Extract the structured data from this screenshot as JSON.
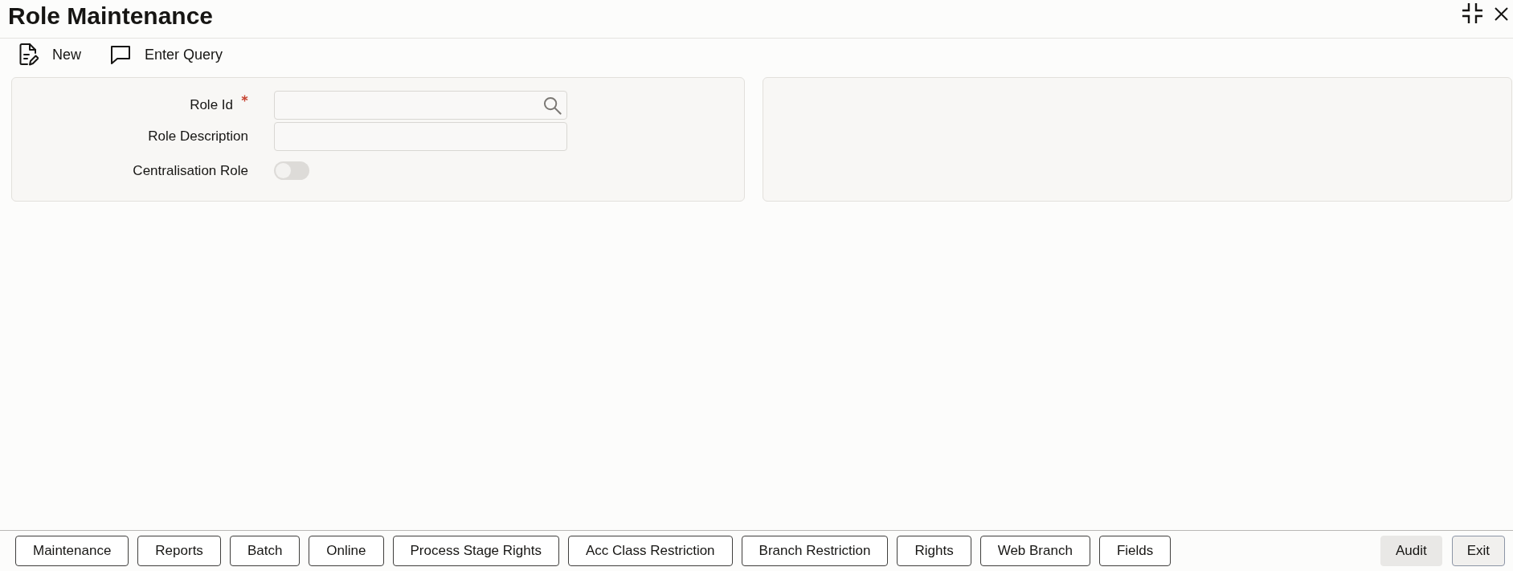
{
  "window": {
    "title": "Role Maintenance"
  },
  "toolbar": [
    {
      "label": "New",
      "kind": "new"
    },
    {
      "label": "Enter Query",
      "kind": "query"
    }
  ],
  "form": {
    "fields": [
      {
        "label": "Role Id",
        "kind": "lookup",
        "required": true
      },
      {
        "label": "Role Description",
        "kind": "text",
        "required": false
      },
      {
        "label": "Centralisation Role",
        "kind": "toggle",
        "required": false,
        "on": false
      }
    ]
  },
  "footer": {
    "buttons": [
      {
        "label": "Maintenance"
      },
      {
        "label": "Reports"
      },
      {
        "label": "Batch"
      },
      {
        "label": "Online"
      },
      {
        "label": "Process Stage Rights"
      },
      {
        "label": "Acc Class Restriction"
      },
      {
        "label": "Branch Restriction"
      },
      {
        "label": "Rights"
      },
      {
        "label": "Web Branch"
      },
      {
        "label": "Fields"
      }
    ],
    "actions": [
      {
        "label": "Audit",
        "kind": "filled"
      },
      {
        "label": "Exit",
        "kind": "outlined"
      }
    ]
  }
}
